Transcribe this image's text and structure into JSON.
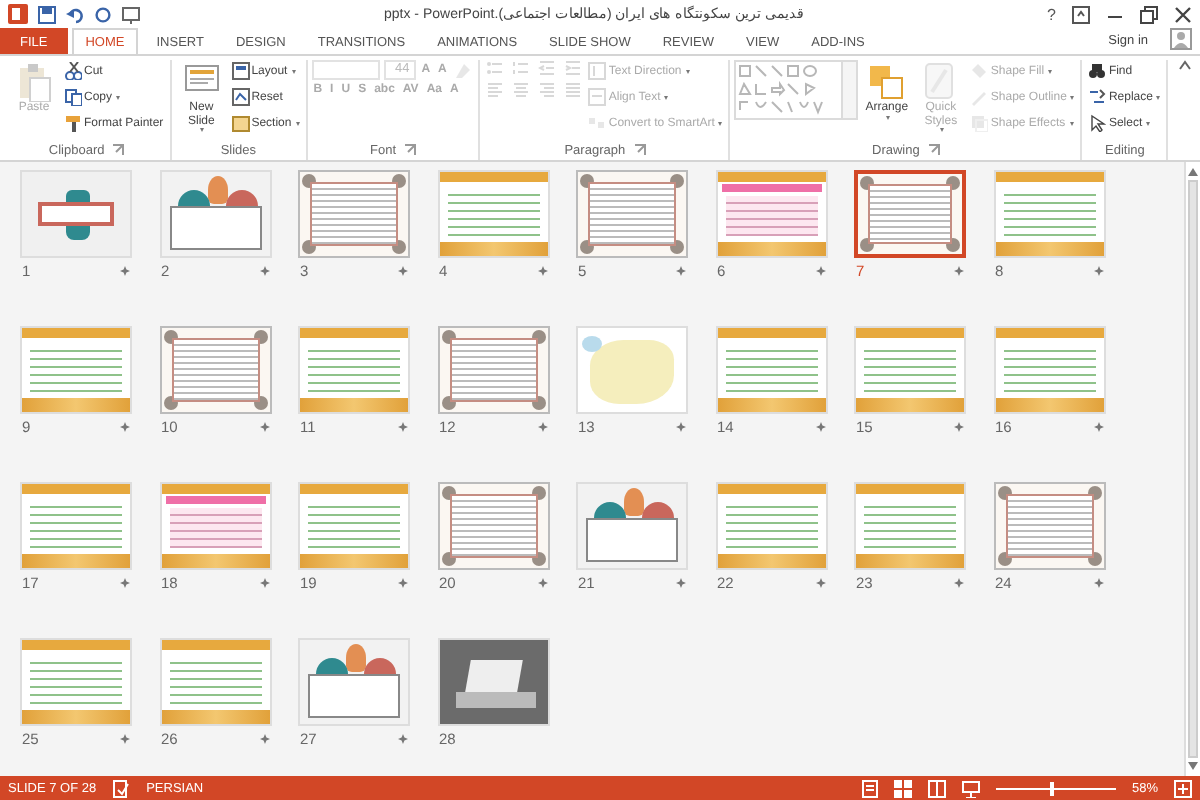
{
  "window": {
    "title": "قدیمی ترین سکونتگاه های ایران (مطالعات اجتماعی).pptx - PowerPoint",
    "help": "?",
    "sign_in": "Sign in"
  },
  "tabs": [
    {
      "label": "FILE",
      "kind": "file",
      "selected": false
    },
    {
      "label": "HOME",
      "kind": "tab",
      "selected": true
    },
    {
      "label": "INSERT",
      "kind": "tab",
      "selected": false
    },
    {
      "label": "DESIGN",
      "kind": "tab",
      "selected": false
    },
    {
      "label": "TRANSITIONS",
      "kind": "tab",
      "selected": false
    },
    {
      "label": "ANIMATIONS",
      "kind": "tab",
      "selected": false
    },
    {
      "label": "SLIDE SHOW",
      "kind": "tab",
      "selected": false
    },
    {
      "label": "REVIEW",
      "kind": "tab",
      "selected": false
    },
    {
      "label": "VIEW",
      "kind": "tab",
      "selected": false
    },
    {
      "label": "ADD-INS",
      "kind": "tab",
      "selected": false
    }
  ],
  "ribbon": [
    {
      "label": "Clipboard",
      "launcher": true,
      "columns": [
        [
          [
            {
              "kind": "large",
              "label": "Paste",
              "disabled": true,
              "caret": false
            }
          ]
        ],
        [
          [
            {
              "kind": "small",
              "label": "Cut",
              "disabled": false,
              "caret": false
            }
          ],
          [
            {
              "kind": "small",
              "label": "Copy",
              "disabled": false,
              "caret": true
            }
          ],
          [
            {
              "kind": "small",
              "label": "Format Painter",
              "disabled": false,
              "caret": false
            }
          ]
        ]
      ]
    },
    {
      "label": "Slides",
      "launcher": false,
      "columns": [
        [
          [
            {
              "kind": "large",
              "label": "New Slide",
              "disabled": false,
              "caret": true
            }
          ]
        ],
        [
          [
            {
              "kind": "small",
              "label": "Layout",
              "disabled": false,
              "caret": true
            }
          ],
          [
            {
              "kind": "small",
              "label": "Reset",
              "disabled": false,
              "caret": false
            }
          ],
          [
            {
              "kind": "small",
              "label": "Section",
              "disabled": false,
              "caret": true
            }
          ]
        ]
      ]
    },
    {
      "label": "Font",
      "launcher": true,
      "columns": [
        [
          [
            {
              "kind": "field",
              "disabled": true
            },
            {
              "kind": "field",
              "value": "44",
              "disabled": true
            },
            {
              "kind": "glyph",
              "label": "A",
              "disabled": true
            },
            {
              "kind": "glyph",
              "label": "A",
              "disabled": true
            },
            {
              "kind": "icon",
              "disabled": true
            }
          ],
          [
            {
              "kind": "glyph",
              "label": "B",
              "disabled": true
            },
            {
              "kind": "glyph",
              "label": "I",
              "disabled": true
            },
            {
              "kind": "glyph",
              "label": "U",
              "disabled": true
            },
            {
              "kind": "glyph",
              "label": "S",
              "disabled": true
            },
            {
              "kind": "glyph",
              "label": "abc",
              "disabled": true
            },
            {
              "kind": "glyph",
              "label": "AV",
              "disabled": true
            },
            {
              "kind": "glyph",
              "label": "Aa",
              "disabled": true
            },
            {
              "kind": "glyph",
              "label": "A",
              "disabled": true
            }
          ]
        ]
      ]
    },
    {
      "label": "Paragraph",
      "launcher": true,
      "columns": [
        [
          [
            {
              "kind": "icon",
              "disabled": true
            },
            {
              "kind": "icon",
              "disabled": true
            },
            {
              "kind": "icon",
              "disabled": true
            },
            {
              "kind": "icon",
              "disabled": true
            }
          ],
          [
            {
              "kind": "icon",
              "disabled": true
            },
            {
              "kind": "icon",
              "disabled": true
            },
            {
              "kind": "icon",
              "disabled": true
            },
            {
              "kind": "icon",
              "disabled": true
            }
          ]
        ],
        [
          [
            {
              "kind": "small",
              "label": "Text Direction",
              "disabled": true,
              "caret": true
            }
          ],
          [
            {
              "kind": "small",
              "label": "Align Text",
              "disabled": true,
              "caret": true
            }
          ],
          [
            {
              "kind": "small",
              "label": "Convert to SmartArt",
              "disabled": true,
              "caret": true
            }
          ]
        ]
      ]
    },
    {
      "label": "Drawing",
      "launcher": true,
      "columns": [
        [
          [
            {
              "kind": "gallery",
              "disabled": true
            }
          ]
        ],
        [
          [
            {
              "kind": "large",
              "label": "Arrange",
              "disabled": false,
              "caret": true
            }
          ]
        ],
        [
          [
            {
              "kind": "large",
              "label": "Quick Styles",
              "disabled": true,
              "caret": true
            }
          ]
        ],
        [
          [
            {
              "kind": "small",
              "label": "Shape Fill",
              "disabled": true,
              "caret": true
            }
          ],
          [
            {
              "kind": "small",
              "label": "Shape Outline",
              "disabled": true,
              "caret": true
            }
          ],
          [
            {
              "kind": "small",
              "label": "Shape Effects",
              "disabled": true,
              "caret": true
            }
          ]
        ]
      ]
    },
    {
      "label": "Editing",
      "launcher": false,
      "columns": [
        [
          [
            {
              "kind": "small",
              "label": "Find",
              "disabled": false,
              "caret": false
            }
          ],
          [
            {
              "kind": "small",
              "label": "Replace",
              "disabled": false,
              "caret": true
            }
          ],
          [
            {
              "kind": "small",
              "label": "Select",
              "disabled": false,
              "caret": true
            }
          ]
        ]
      ]
    }
  ],
  "slides": [
    {
      "number": "1",
      "kind": "cover",
      "selected": false,
      "transition": true
    },
    {
      "number": "2",
      "kind": "title",
      "selected": false,
      "transition": true
    },
    {
      "number": "3",
      "kind": "frame",
      "selected": false,
      "transition": true
    },
    {
      "number": "4",
      "kind": "banner",
      "selected": false,
      "transition": true
    },
    {
      "number": "5",
      "kind": "frame",
      "selected": false,
      "transition": true
    },
    {
      "number": "6",
      "kind": "pink",
      "selected": false,
      "transition": true
    },
    {
      "number": "7",
      "kind": "frame",
      "selected": true,
      "transition": true
    },
    {
      "number": "8",
      "kind": "banner",
      "selected": false,
      "transition": true
    },
    {
      "number": "9",
      "kind": "banner",
      "selected": false,
      "transition": true
    },
    {
      "number": "10",
      "kind": "frame",
      "selected": false,
      "transition": true
    },
    {
      "number": "11",
      "kind": "banner",
      "selected": false,
      "transition": true
    },
    {
      "number": "12",
      "kind": "frame",
      "selected": false,
      "transition": true
    },
    {
      "number": "13",
      "kind": "map",
      "selected": false,
      "transition": true
    },
    {
      "number": "14",
      "kind": "banner",
      "selected": false,
      "transition": true
    },
    {
      "number": "15",
      "kind": "banner",
      "selected": false,
      "transition": true
    },
    {
      "number": "16",
      "kind": "banner",
      "selected": false,
      "transition": true
    },
    {
      "number": "17",
      "kind": "banner",
      "selected": false,
      "transition": true
    },
    {
      "number": "18",
      "kind": "pink",
      "selected": false,
      "transition": true
    },
    {
      "number": "19",
      "kind": "banner",
      "selected": false,
      "transition": true
    },
    {
      "number": "20",
      "kind": "frame",
      "selected": false,
      "transition": true
    },
    {
      "number": "21",
      "kind": "title",
      "selected": false,
      "transition": true
    },
    {
      "number": "22",
      "kind": "banner",
      "selected": false,
      "transition": true
    },
    {
      "number": "23",
      "kind": "banner",
      "selected": false,
      "transition": true
    },
    {
      "number": "24",
      "kind": "frame",
      "selected": false,
      "transition": true
    },
    {
      "number": "25",
      "kind": "banner",
      "selected": false,
      "transition": true
    },
    {
      "number": "26",
      "kind": "banner",
      "selected": false,
      "transition": true
    },
    {
      "number": "27",
      "kind": "title",
      "selected": false,
      "transition": true
    },
    {
      "number": "28",
      "kind": "photo",
      "selected": false,
      "transition": false
    }
  ],
  "status_bar": {
    "slide": "SLIDE 7 OF 28",
    "language": "PERSIAN",
    "zoom": "58%",
    "zoom_slider": {
      "level": 0.45
    }
  }
}
